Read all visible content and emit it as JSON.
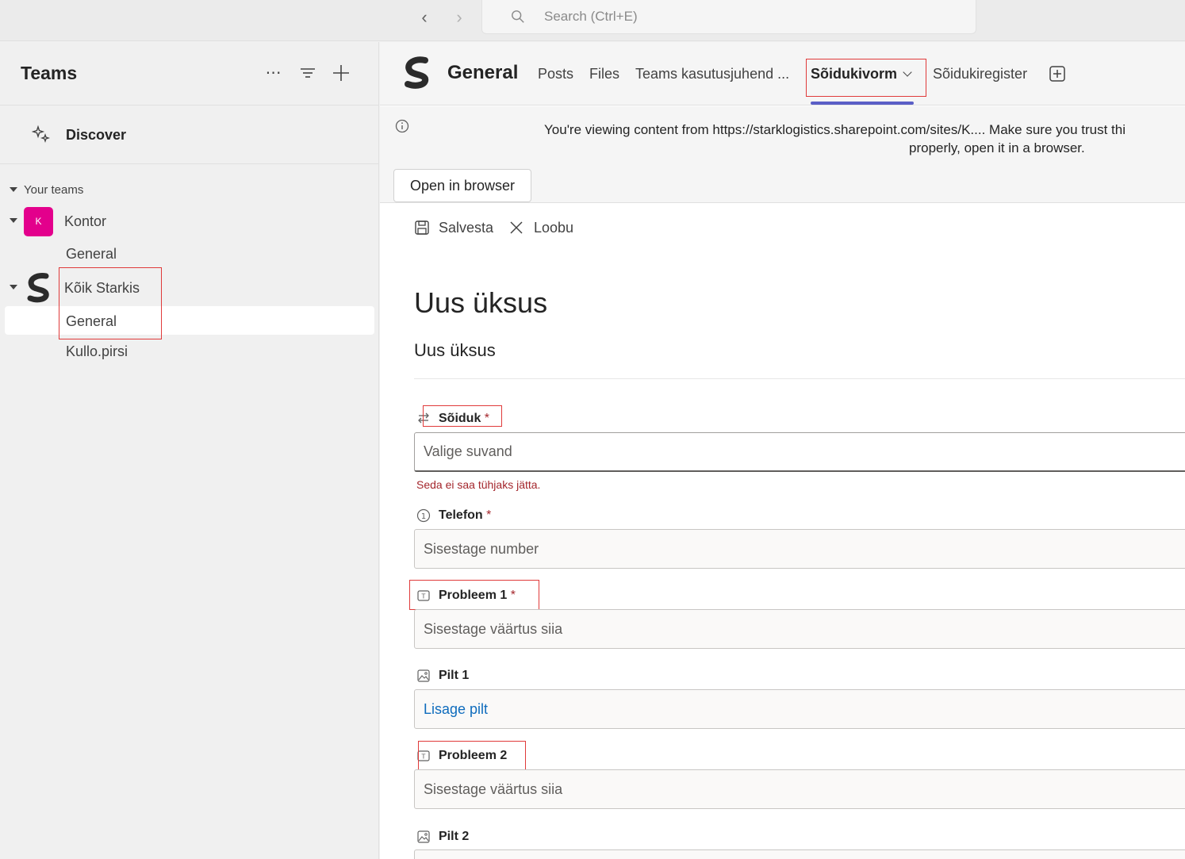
{
  "topbar": {
    "search_placeholder": "Search (Ctrl+E)"
  },
  "sidebar": {
    "title": "Teams",
    "discover": "Discover",
    "section": "Your teams",
    "teams": [
      {
        "name": "Kontor",
        "avatar_letter": "K",
        "avatar_color": "#e3008c",
        "channels": [
          "General"
        ]
      },
      {
        "name": "Kõik Starkis",
        "channels": [
          "General",
          "Kullo.pirsi"
        ]
      }
    ]
  },
  "channel": {
    "title": "General",
    "tabs": [
      {
        "label": "Posts"
      },
      {
        "label": "Files"
      },
      {
        "label": "Teams kasutusjuhend ..."
      },
      {
        "label": "Sõidukivorm",
        "active": true
      },
      {
        "label": "Sõidukiregister"
      }
    ],
    "accent_color": "#5b5fc7"
  },
  "banner": {
    "line1": "You're viewing content from https://starklogistics.sharepoint.com/sites/K.... Make sure you trust thi",
    "line2": "properly, open it in a browser.",
    "open_button": "Open in browser"
  },
  "form": {
    "save": "Salvesta",
    "cancel": "Loobu",
    "heading": "Uus üksus",
    "subheading": "Uus üksus",
    "fields": [
      {
        "label": "Sõiduk",
        "required": "*",
        "placeholder": "Valige suvand",
        "error": "Seda ei saa tühjaks jätta."
      },
      {
        "label": "Telefon",
        "required": "*",
        "placeholder": "Sisestage number"
      },
      {
        "label": "Probleem 1",
        "required": "*",
        "placeholder": "Sisestage väärtus siia"
      },
      {
        "label": "Pilt 1",
        "value": "Lisage pilt"
      },
      {
        "label": "Probleem 2",
        "placeholder": "Sisestage väärtus siia"
      },
      {
        "label": "Pilt 2"
      }
    ]
  }
}
